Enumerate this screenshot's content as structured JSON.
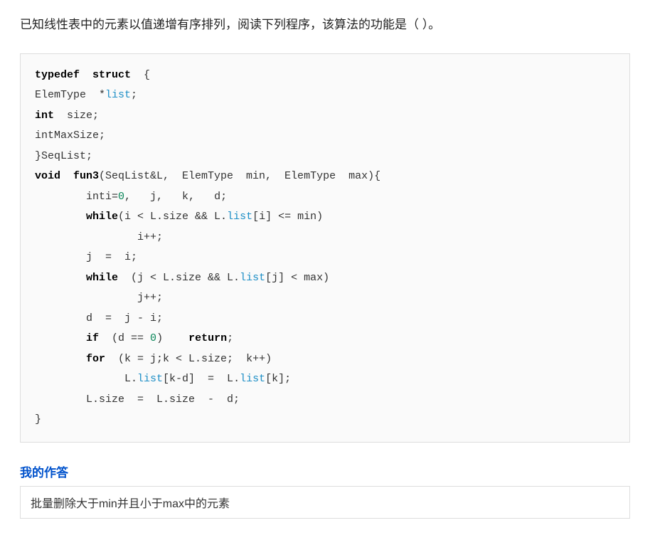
{
  "question": "已知线性表中的元素以值递增有序排列，阅读下列程序，该算法的功能是（ ）。",
  "code": {
    "l1_kw": "typedef  struct",
    "l1_rest": "  {",
    "l2_a": "ElemType  *",
    "l2_b": "list",
    "l2_c": ";",
    "l3_kw": "int",
    "l3_rest": "  size;",
    "l4": "intMaxSize;",
    "l5": "}SeqList;",
    "l6_kw": "void  fun3",
    "l6_rest": "(SeqList&L,  ElemType  min,  ElemType  max){",
    "l7_a": "        inti=",
    "l7_num": "0",
    "l7_b": ",   j,   k,   d;",
    "l8_a": "        ",
    "l8_kw": "while",
    "l8_b": "(i < L.size && L.",
    "l8_c": "list",
    "l8_d": "[i] <= min)",
    "l9": "                i++;",
    "l10": "        j  =  i;",
    "l11_a": "        ",
    "l11_kw": "while",
    "l11_b": "  (j < L.size && L.",
    "l11_c": "list",
    "l11_d": "[j] < max)",
    "l12": "                j++;",
    "l13": "        d  =  j - i;",
    "l14_a": "        ",
    "l14_kw": "if",
    "l14_b": "  (d == ",
    "l14_num": "0",
    "l14_c": ")    ",
    "l14_kw2": "return",
    "l14_d": ";",
    "l15_a": "        ",
    "l15_kw": "for",
    "l15_b": "  (k = j;k < L.size;  k++)",
    "l16_a": "              L.",
    "l16_b": "list",
    "l16_c": "[k-d]  =  L.",
    "l16_d": "list",
    "l16_e": "[k];",
    "l17": "        L.size  =  L.size  -  d;",
    "l18": "}"
  },
  "section_title": "我的作答",
  "answer": "批量删除大于min并且小于max中的元素"
}
